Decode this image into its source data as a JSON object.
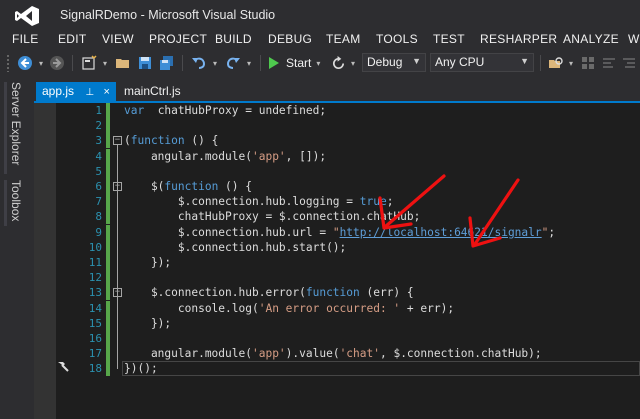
{
  "window": {
    "title": "SignalRDemo - Microsoft Visual Studio"
  },
  "menu": [
    "FILE",
    "EDIT",
    "VIEW",
    "PROJECT",
    "BUILD",
    "DEBUG",
    "TEAM",
    "TOOLS",
    "TEST",
    "RESHARPER",
    "ANALYZE",
    "W"
  ],
  "toolbar": {
    "start_label": "Start",
    "configuration": "Debug",
    "platform": "Any CPU"
  },
  "side_tabs": [
    "Server Explorer",
    "Toolbox"
  ],
  "doc_tabs": [
    {
      "label": "app.js",
      "pin": "⊥",
      "close": "×"
    },
    {
      "label": "mainCtrl.js"
    }
  ],
  "code": {
    "line_numbers": [
      "1",
      "2",
      "3",
      "4",
      "5",
      "6",
      "7",
      "8",
      "9",
      "10",
      "11",
      "12",
      "13",
      "14",
      "15",
      "16",
      "17",
      "18"
    ],
    "lines": [
      {
        "parts": [
          [
            "kw",
            "var"
          ],
          [
            "",
            "  chatHubProxy = undefined;"
          ]
        ]
      },
      {
        "parts": []
      },
      {
        "parts": [
          [
            "",
            "("
          ],
          [
            "kw",
            "function"
          ],
          [
            "",
            " () {"
          ]
        ]
      },
      {
        "parts": [
          [
            "",
            "    angular.module("
          ],
          [
            "str",
            "'app'"
          ],
          [
            "",
            ", []);"
          ]
        ]
      },
      {
        "parts": []
      },
      {
        "parts": [
          [
            "",
            "    $("
          ],
          [
            "kw",
            "function"
          ],
          [
            "",
            " () {"
          ]
        ]
      },
      {
        "parts": [
          [
            "",
            "        $.connection.hub.logging = "
          ],
          [
            "kw",
            "true"
          ],
          [
            "",
            ";"
          ]
        ]
      },
      {
        "parts": [
          [
            "",
            "        chatHubProxy = $.connection.chatHub;"
          ]
        ]
      },
      {
        "parts": [
          [
            "",
            "        $.connection.hub.url = "
          ],
          [
            "str",
            "\""
          ],
          [
            "url",
            "http://localhost:64621/signalr"
          ],
          [
            "str",
            "\""
          ],
          [
            "",
            ";"
          ]
        ]
      },
      {
        "parts": [
          [
            "",
            "        $.connection.hub.start();"
          ]
        ]
      },
      {
        "parts": [
          [
            "",
            "    });"
          ]
        ]
      },
      {
        "parts": []
      },
      {
        "parts": [
          [
            "",
            "    $.connection.hub.error("
          ],
          [
            "kw",
            "function"
          ],
          [
            "",
            " (err) {"
          ]
        ]
      },
      {
        "parts": [
          [
            "",
            "        console.log("
          ],
          [
            "str",
            "'An error occurred: '"
          ],
          [
            "",
            " + err);"
          ]
        ]
      },
      {
        "parts": [
          [
            "",
            "    });"
          ]
        ]
      },
      {
        "parts": []
      },
      {
        "parts": [
          [
            "",
            "    angular.module("
          ],
          [
            "str",
            "'app'"
          ],
          [
            "",
            ").value("
          ],
          [
            "str",
            "'chat'"
          ],
          [
            "",
            ", $.connection.chatHub);"
          ]
        ]
      },
      {
        "parts": [
          [
            "",
            "})();"
          ]
        ]
      }
    ]
  },
  "colors": {
    "accent": "#007acc",
    "annotation_arrow": "#ee1111"
  }
}
